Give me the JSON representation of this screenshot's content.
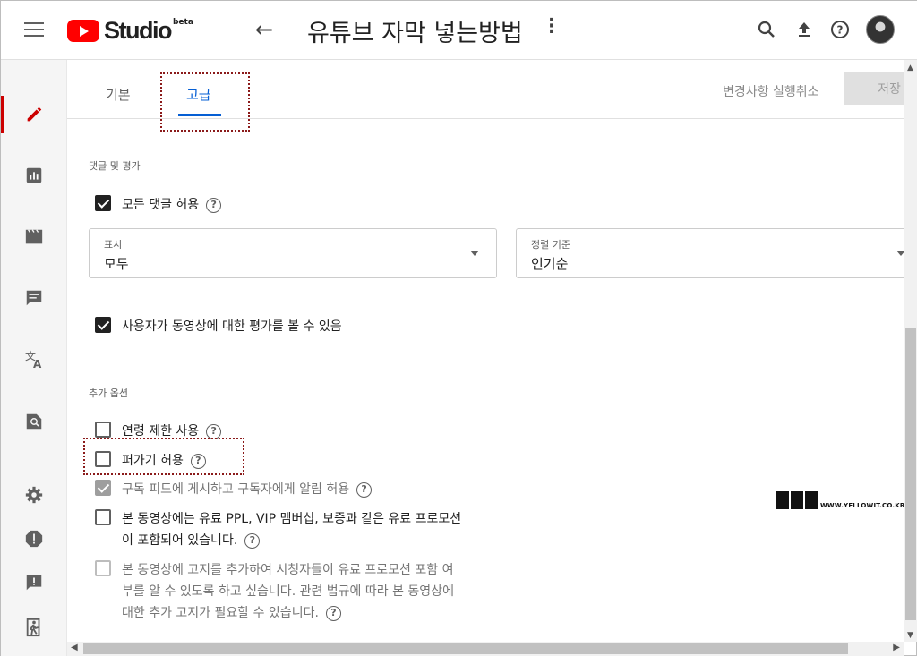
{
  "header": {
    "logo_text": "Studio",
    "logo_badge": "beta",
    "video_title": "유튜브 자막 넣는방법",
    "icons": [
      "menu-icon",
      "back-arrow-icon",
      "more-vert-icon",
      "search-icon",
      "upload-icon",
      "help-icon",
      "avatar"
    ]
  },
  "sidebar": {
    "items": [
      {
        "icon": "pencil-icon",
        "active": true
      },
      {
        "icon": "analytics-icon",
        "active": false
      },
      {
        "icon": "editor-icon",
        "active": false
      },
      {
        "icon": "comments-icon",
        "active": false
      },
      {
        "icon": "translate-icon",
        "active": false
      },
      {
        "icon": "copyright-icon",
        "active": false
      },
      {
        "icon": "settings-icon",
        "active": false
      },
      {
        "icon": "alert-icon",
        "active": false
      },
      {
        "icon": "feedback-icon",
        "active": false
      },
      {
        "icon": "exit-icon",
        "active": false
      }
    ]
  },
  "tabs": {
    "basic": "기본",
    "advanced": "고급",
    "active": "advanced"
  },
  "actions": {
    "undo": "변경사항 실행취소",
    "save": "저장"
  },
  "comments": {
    "section_title": "댓글 및 평가",
    "allow_all": {
      "label": "모든 댓글 허용",
      "checked": true
    },
    "display_select": {
      "caption": "표시",
      "value": "모두"
    },
    "sort_select": {
      "caption": "정렬 기준",
      "value": "인기순"
    },
    "show_ratings": {
      "label": "사용자가 동영상에 대한 평가를 볼 수 있음",
      "checked": true
    }
  },
  "more_options": {
    "section_title": "추가 옵션",
    "age_restriction": {
      "label": "연령 제한 사용",
      "checked": false
    },
    "allow_embedding": {
      "label": "퍼가기 허용",
      "checked": false
    },
    "notify_subscribers": {
      "label": "구독 피드에 게시하고 구독자에게 알림 허용",
      "checked": true,
      "disabled": true
    },
    "paid_promotion": {
      "line1": "본 동영상에는 유료 PPL, VIP 멤버십, 보증과 같은 유료 프로모션",
      "line2": "이 포함되어 있습니다.",
      "checked": false
    },
    "paid_notice": {
      "line1": "본 동영상에 고지를 추가하여 시청자들이 유료 프로모션 포함 여",
      "line2": "부를 알 수 있도록 하고 싶습니다. 관련 법규에 따라 본 동영상에",
      "line3": "대한 추가 고지가 필요할 수 있습니다.",
      "checked": false,
      "disabled": true
    }
  },
  "watermark": {
    "text": "WWW.YELLOWIT.CO.KR"
  },
  "colors": {
    "accent": "#065fd4",
    "brand_red": "#ff0000",
    "active_rail": "#cc0000",
    "annotation": "#8b1a1a"
  }
}
